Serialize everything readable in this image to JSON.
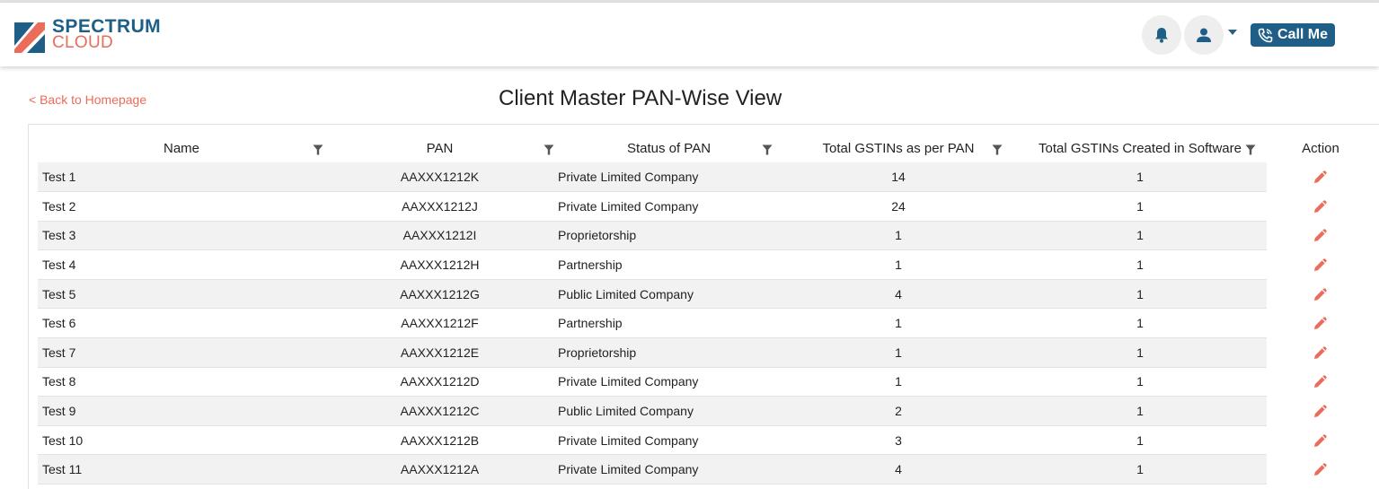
{
  "brand": {
    "line1": "SPECTRUM",
    "line2": "CLOUD",
    "primary_color": "#1f5f87",
    "accent_color": "#ea6c5a"
  },
  "header": {
    "notifications_icon": "bell-icon",
    "user_icon": "user-icon",
    "call_button_label": "Call Me",
    "call_icon": "phone-icon"
  },
  "nav": {
    "back_label": "< Back to Homepage"
  },
  "page": {
    "title": "Client Master PAN-Wise View"
  },
  "table": {
    "columns": [
      "Name",
      "PAN",
      "Status of PAN",
      "Total GSTINs as per PAN",
      "Total GSTINs Created in Software",
      "Action"
    ],
    "action_icon": "edit-pencil-icon",
    "rows": [
      {
        "name": "Test 1",
        "pan": "AAXXX1212K",
        "status": "Private Limited Company",
        "gstins_per_pan": "14",
        "gstins_created": "1"
      },
      {
        "name": "Test 2",
        "pan": "AAXXX1212J",
        "status": "Private Limited Company",
        "gstins_per_pan": "24",
        "gstins_created": "1"
      },
      {
        "name": "Test 3",
        "pan": "AAXXX1212I",
        "status": "Proprietorship",
        "gstins_per_pan": "1",
        "gstins_created": "1"
      },
      {
        "name": "Test 4",
        "pan": "AAXXX1212H",
        "status": "Partnership",
        "gstins_per_pan": "1",
        "gstins_created": "1"
      },
      {
        "name": "Test 5",
        "pan": "AAXXX1212G",
        "status": "Public Limited Company",
        "gstins_per_pan": "4",
        "gstins_created": "1"
      },
      {
        "name": "Test 6",
        "pan": "AAXXX1212F",
        "status": "Partnership",
        "gstins_per_pan": "1",
        "gstins_created": "1"
      },
      {
        "name": "Test 7",
        "pan": "AAXXX1212E",
        "status": "Proprietorship",
        "gstins_per_pan": "1",
        "gstins_created": "1"
      },
      {
        "name": "Test 8",
        "pan": "AAXXX1212D",
        "status": "Private Limited Company",
        "gstins_per_pan": "1",
        "gstins_created": "1"
      },
      {
        "name": "Test 9",
        "pan": "AAXXX1212C",
        "status": "Public Limited Company",
        "gstins_per_pan": "2",
        "gstins_created": "1"
      },
      {
        "name": "Test 10",
        "pan": "AAXXX1212B",
        "status": "Private Limited Company",
        "gstins_per_pan": "3",
        "gstins_created": "1"
      },
      {
        "name": "Test 11",
        "pan": "AAXXX1212A",
        "status": "Private Limited Company",
        "gstins_per_pan": "4",
        "gstins_created": "1"
      }
    ]
  }
}
